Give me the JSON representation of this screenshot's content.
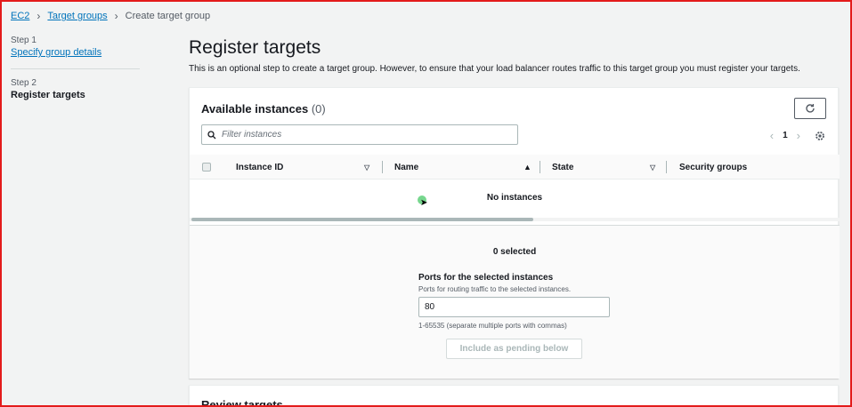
{
  "breadcrumb": {
    "items": [
      "EC2",
      "Target groups"
    ],
    "current": "Create target group"
  },
  "nav": {
    "step1_num": "Step 1",
    "step1_label": "Specify group details",
    "step2_num": "Step 2",
    "step2_label": "Register targets"
  },
  "main": {
    "title": "Register targets",
    "description": "This is an optional step to create a target group. However, to ensure that your load balancer routes traffic to this target group you must register your targets."
  },
  "available": {
    "title": "Available instances",
    "count": "(0)",
    "filter_placeholder": "Filter instances",
    "page": "1",
    "columns": [
      "Instance ID",
      "Name",
      "State",
      "Security groups"
    ],
    "empty_text": "No instances"
  },
  "selection": {
    "selected_text": "0 selected",
    "ports_label": "Ports for the selected instances",
    "ports_description": "Ports for routing traffic to the selected instances.",
    "ports_value": "80",
    "ports_hint": "1-65535 (separate multiple ports with commas)",
    "include_button": "Include as pending below"
  },
  "review": {
    "title": "Review targets"
  },
  "icons": [
    "chevron-right-icon",
    "refresh-icon",
    "search-icon",
    "chevron-left-icon",
    "gear-icon",
    "sort-down-icon",
    "sort-up-icon",
    "cursor-icon"
  ],
  "colors": {
    "link": "#0073bb",
    "frame": "#e31b1b",
    "background": "#f2f3f3"
  }
}
